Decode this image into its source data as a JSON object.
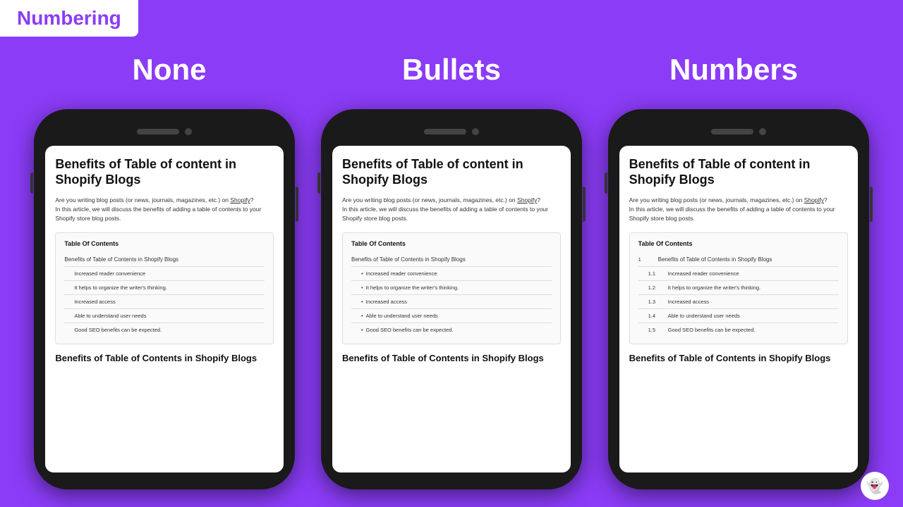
{
  "header": {
    "badge_label": "Numbering"
  },
  "columns": [
    {
      "label": "None"
    },
    {
      "label": "Bullets"
    },
    {
      "label": "Numbers"
    }
  ],
  "phones": [
    {
      "id": "none",
      "title": "Benefits of Table of content in Shopify Blogs",
      "intro_line1": "Are you writing blog posts (or news, journals, magazines, etc.) on Shopify?",
      "intro_line2": "In this article, we will discuss the benefits of adding a table of contents to your Shopify store blog posts.",
      "toc_title": "Table Of Contents",
      "toc_items": [
        {
          "level": 0,
          "prefix": "",
          "text": "Benefits of Table of Contents in Shopify Blogs"
        },
        {
          "level": 1,
          "prefix": "",
          "text": "Increased reader convenience"
        },
        {
          "level": 1,
          "prefix": "",
          "text": "It helps to organize the writer's thinking."
        },
        {
          "level": 1,
          "prefix": "",
          "text": "Increased access"
        },
        {
          "level": 1,
          "prefix": "",
          "text": "Able to understand user needs"
        },
        {
          "level": 1,
          "prefix": "",
          "text": "Good SEO benefits can be expected."
        }
      ],
      "bottom_heading": "Benefits of Table of Contents in Shopify Blogs"
    },
    {
      "id": "bullets",
      "title": "Benefits of Table of content in Shopify Blogs",
      "intro_line1": "Are you writing blog posts (or news, journals, magazines, etc.) on Shopify?",
      "intro_line2": "In this article, we will discuss the benefits of adding a table of contents to your Shopify store blog posts.",
      "toc_title": "Table Of Contents",
      "toc_items": [
        {
          "level": 0,
          "prefix": "",
          "text": "Benefits of Table of Contents in Shopify Blogs"
        },
        {
          "level": 1,
          "prefix": "•",
          "text": "Increased reader convenience"
        },
        {
          "level": 1,
          "prefix": "•",
          "text": "It helps to organize the writer's thinking."
        },
        {
          "level": 1,
          "prefix": "•",
          "text": "Increased access"
        },
        {
          "level": 1,
          "prefix": "•",
          "text": "Able to understand user needs"
        },
        {
          "level": 1,
          "prefix": "•",
          "text": "Good SEO benefits can be expected."
        }
      ],
      "bottom_heading": "Benefits of Table of Contents in Shopify Blogs"
    },
    {
      "id": "numbers",
      "title": "Benefits of Table of content in Shopify Blogs",
      "intro_line1": "Are you writing blog posts (or news, journals, magazines, etc.) on Shopify?",
      "intro_line2": "In this article, we will discuss the benefits of adding a table of contents to your Shopify store blog posts.",
      "toc_title": "Table Of Contents",
      "toc_items": [
        {
          "level": 0,
          "prefix": "1",
          "text": "Benefits of Table of Contents in Shopify Blogs"
        },
        {
          "level": 1,
          "prefix": "1.1",
          "text": "Increased reader convenience"
        },
        {
          "level": 1,
          "prefix": "1.2",
          "text": "It helps to organize the writer's thinking."
        },
        {
          "level": 1,
          "prefix": "1.3",
          "text": "Increased access"
        },
        {
          "level": 1,
          "prefix": "1.4",
          "text": "Able to understand user needs"
        },
        {
          "level": 1,
          "prefix": "1.5",
          "text": "Good SEO benefits can be expected."
        }
      ],
      "bottom_heading": "Benefits of Table of Contents in Shopify Blogs"
    }
  ]
}
